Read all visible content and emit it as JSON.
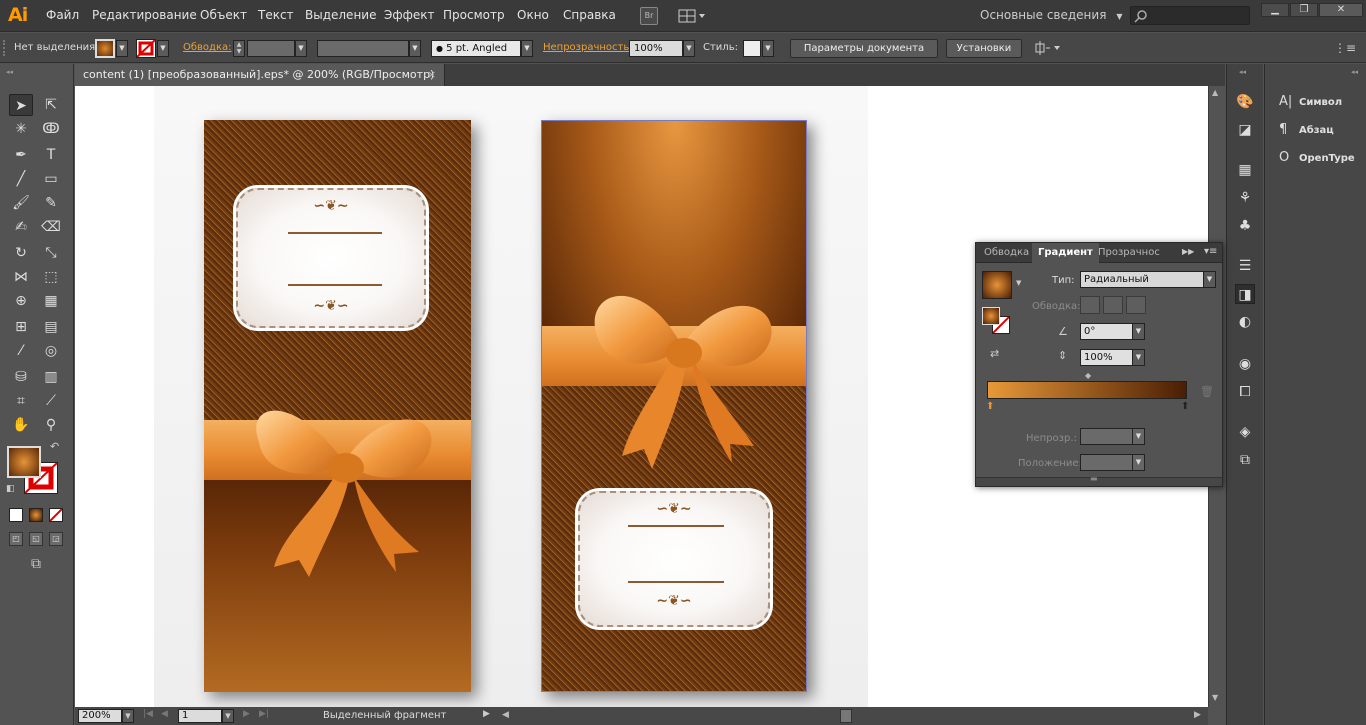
{
  "app": {
    "logo": "Ai"
  },
  "menu": {
    "items": [
      "Файл",
      "Редактирование",
      "Объект",
      "Текст",
      "Выделение",
      "Эффект",
      "Просмотр",
      "Окно",
      "Справка"
    ],
    "bridge": "Br",
    "workspace": "Основные сведения"
  },
  "control": {
    "selection": "Нет выделения",
    "stroke_label": "Обводка:",
    "brush_value": "5 pt. Angled",
    "opacity_label": "Непрозрачность:",
    "opacity_value": "100%",
    "style_label": "Стиль:",
    "doc_settings": "Параметры документа",
    "preferences": "Установки"
  },
  "document": {
    "tab_title": "content (1) [преобразованный].eps* @ 200% (RGB/Просмотр)",
    "close": "×"
  },
  "status": {
    "zoom": "200%",
    "artboard": "1",
    "selection_info": "Выделенный фрагмент"
  },
  "right_panel": {
    "items": [
      {
        "icon": "A|",
        "label": "Символ"
      },
      {
        "icon": "¶",
        "label": "Абзац"
      },
      {
        "icon": "O",
        "label": "OpenType"
      }
    ]
  },
  "gradient_panel": {
    "tabs": [
      "Обводка",
      "Градиент",
      "Прозрачнос"
    ],
    "type_label": "Тип:",
    "type_value": "Радиальный",
    "stroke_label": "Обводка:",
    "angle_value": "0°",
    "aspect_value": "100%",
    "opacity_label": "Непрозр.:",
    "position_label": "Положение:"
  },
  "colors": {
    "accent": "#f0a030",
    "gradient_start": "#e89838",
    "gradient_end": "#4a1e04",
    "card_brown": "#6a3610"
  }
}
